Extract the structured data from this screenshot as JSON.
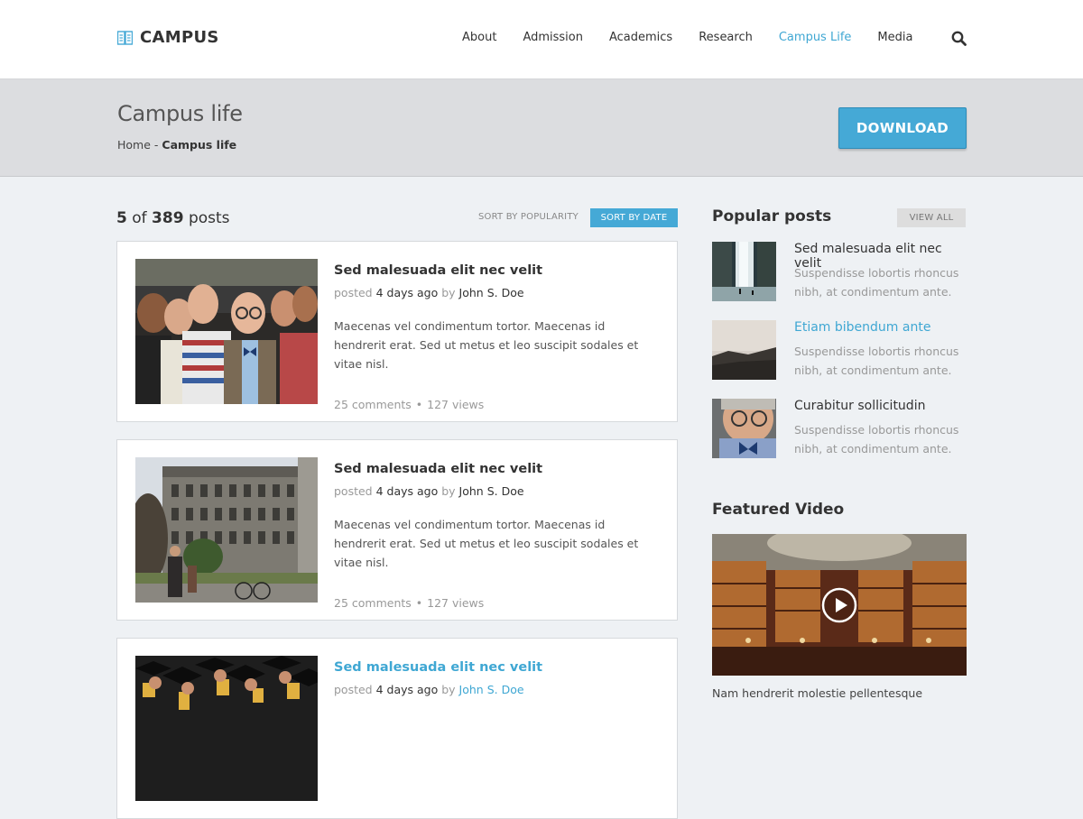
{
  "header": {
    "logo_text": "CAMPUS",
    "nav": [
      "About",
      "Admission",
      "Academics",
      "Research",
      "Campus Life",
      "Media"
    ],
    "active_nav": "Campus Life"
  },
  "title_bar": {
    "title": "Campus life",
    "breadcrumb_home": "Home",
    "breadcrumb_sep": " - ",
    "breadcrumb_current": "Campus life",
    "download_label": "DOWNLOAD"
  },
  "posts_header": {
    "shown": "5",
    "of": " of ",
    "total": "389",
    "suffix": " posts",
    "sort_popularity": "SORT BY POPULARITY",
    "sort_date": "SORT BY DATE"
  },
  "posts": [
    {
      "title": "Sed malesuada elit nec velit",
      "posted": "posted ",
      "date": "4 days ago",
      "by": " by ",
      "author": "John S. Doe",
      "excerpt": "Maecenas vel condimentum tortor. Maecenas id hendrerit erat. Sed ut metus et leo suscipit sodales et vitae nisl.",
      "comments": "25 comments",
      "views": "127 views"
    },
    {
      "title": "Sed malesuada elit nec velit",
      "posted": "posted ",
      "date": "4 days ago",
      "by": " by ",
      "author": "John S. Doe",
      "excerpt": "Maecenas vel condimentum tortor. Maecenas id hendrerit erat. Sed ut metus et leo suscipit sodales et vitae nisl.",
      "comments": "25 comments",
      "views": "127 views"
    },
    {
      "title": "Sed malesuada elit nec velit",
      "posted": "posted ",
      "date": "4 days ago",
      "by": " by ",
      "author": "John S. Doe"
    }
  ],
  "sidebar": {
    "popular_heading": "Popular posts",
    "view_all": "VIEW ALL",
    "popular": [
      {
        "title": "Sed malesuada elit nec velit",
        "desc": "Suspendisse lobortis rhoncus nibh, at condimentum ante."
      },
      {
        "title": "Etiam bibendum ante",
        "desc": "Suspendisse lobortis rhoncus nibh, at condimentum ante."
      },
      {
        "title": "Curabitur sollicitudin",
        "desc": "Suspendisse lobortis rhoncus nibh, at condimentum ante."
      }
    ],
    "video_heading": "Featured Video",
    "video_caption": "Nam hendrerit molestie pellentesque"
  },
  "colors": {
    "accent": "#45a9d6",
    "link": "#3fa7d3",
    "text": "#333333",
    "muted": "#999999"
  }
}
